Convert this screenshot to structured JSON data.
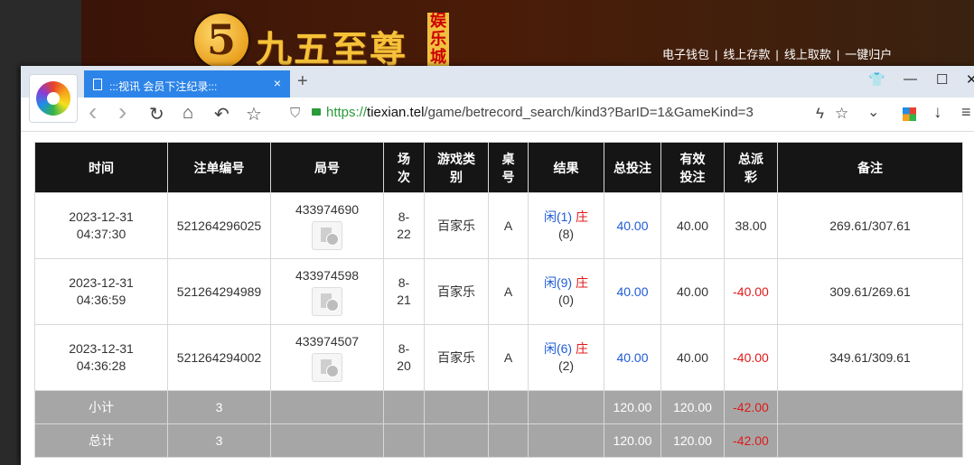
{
  "banner": {
    "logo_number": "5",
    "logo_text": "九五至尊",
    "logo_side": "娱乐城",
    "nav": [
      "电子钱包",
      "线上存款",
      "线上取款",
      "一键归户"
    ],
    "nav_sep": "|"
  },
  "browser": {
    "tab_title": ":::视讯 会员下注纪录:::",
    "tab_close": "×",
    "new_tab": "+",
    "url_scheme": "https://",
    "url_host": "tiexian.tel",
    "url_path": "/game/betrecord_search/kind3?BarID=1&GameKind=3",
    "window_controls": {
      "shirt": "👕",
      "minimize": "—",
      "maximize": "☐",
      "close": "✕"
    },
    "toolbar_icons": {
      "back": "‹",
      "forward": "›",
      "reload": "↻",
      "home": "⌂",
      "undo": "↶",
      "star": "☆",
      "shield": "⛉",
      "bolt": "ϟ",
      "star2": "☆",
      "chevron": "⌄",
      "download": "↓",
      "menu": "≡"
    }
  },
  "table": {
    "headers": [
      "时间",
      "注单编号",
      "局号",
      "场次",
      "游戏类别",
      "桌号",
      "结果",
      "总投注",
      "有效投注",
      "总派彩",
      "备注"
    ],
    "rows": [
      {
        "time_date": "2023-12-31",
        "time_clock": "04:37:30",
        "bet_id": "521264296025",
        "round_id": "433974690",
        "session": "8-22",
        "game": "百家乐",
        "table": "A",
        "result_player": "闲(1)",
        "result_banker": "庄",
        "result_extra": "(8)",
        "total_bet": "40.00",
        "valid_bet": "40.00",
        "payout": "38.00",
        "payout_color": "#333333",
        "remark": "269.61/307.61"
      },
      {
        "time_date": "2023-12-31",
        "time_clock": "04:36:59",
        "bet_id": "521264294989",
        "round_id": "433974598",
        "session": "8-21",
        "game": "百家乐",
        "table": "A",
        "result_player": "闲(9)",
        "result_banker": "庄",
        "result_extra": "(0)",
        "total_bet": "40.00",
        "valid_bet": "40.00",
        "payout": "-40.00",
        "payout_color": "#e01919",
        "remark": "309.61/269.61"
      },
      {
        "time_date": "2023-12-31",
        "time_clock": "04:36:28",
        "bet_id": "521264294002",
        "round_id": "433974507",
        "session": "8-20",
        "game": "百家乐",
        "table": "A",
        "result_player": "闲(6)",
        "result_banker": "庄",
        "result_extra": "(2)",
        "total_bet": "40.00",
        "valid_bet": "40.00",
        "payout": "-40.00",
        "payout_color": "#e01919",
        "remark": "349.61/309.61"
      }
    ],
    "subtotal": {
      "label": "小计",
      "count": "3",
      "total_bet": "120.00",
      "valid_bet": "120.00",
      "payout": "-42.00"
    },
    "total": {
      "label": "总计",
      "count": "3",
      "total_bet": "120.00",
      "valid_bet": "120.00",
      "payout": "-42.00"
    }
  },
  "colors": {
    "tab_active": "#2c84e8",
    "header_bg": "#151515",
    "sum_bg": "#a6a6a6",
    "negative": "#e01919",
    "bet_blue": "#1f5bd6"
  }
}
